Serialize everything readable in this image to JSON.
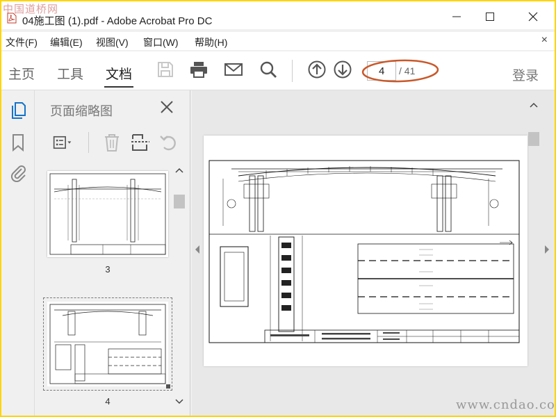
{
  "window": {
    "title": "04施工图 (1).pdf - Adobe Acrobat Pro DC",
    "watermark": "中国道桥网"
  },
  "menu": {
    "items": [
      "文件(F)",
      "编辑(E)",
      "视图(V)",
      "窗口(W)",
      "帮助(H)"
    ],
    "close": "×"
  },
  "toolbar": {
    "tabs": [
      "主页",
      "工具",
      "文档"
    ],
    "active_tab": "文档",
    "page_current": "4",
    "page_total": "/ 41",
    "login": "登录"
  },
  "thumbnail_panel": {
    "title": "页面缩略图",
    "pages": [
      "3",
      "4"
    ]
  },
  "footer_watermark": "www.cndao.com",
  "colors": {
    "highlight_ellipse": "#c9582a",
    "accent_border": "#ffd400"
  }
}
